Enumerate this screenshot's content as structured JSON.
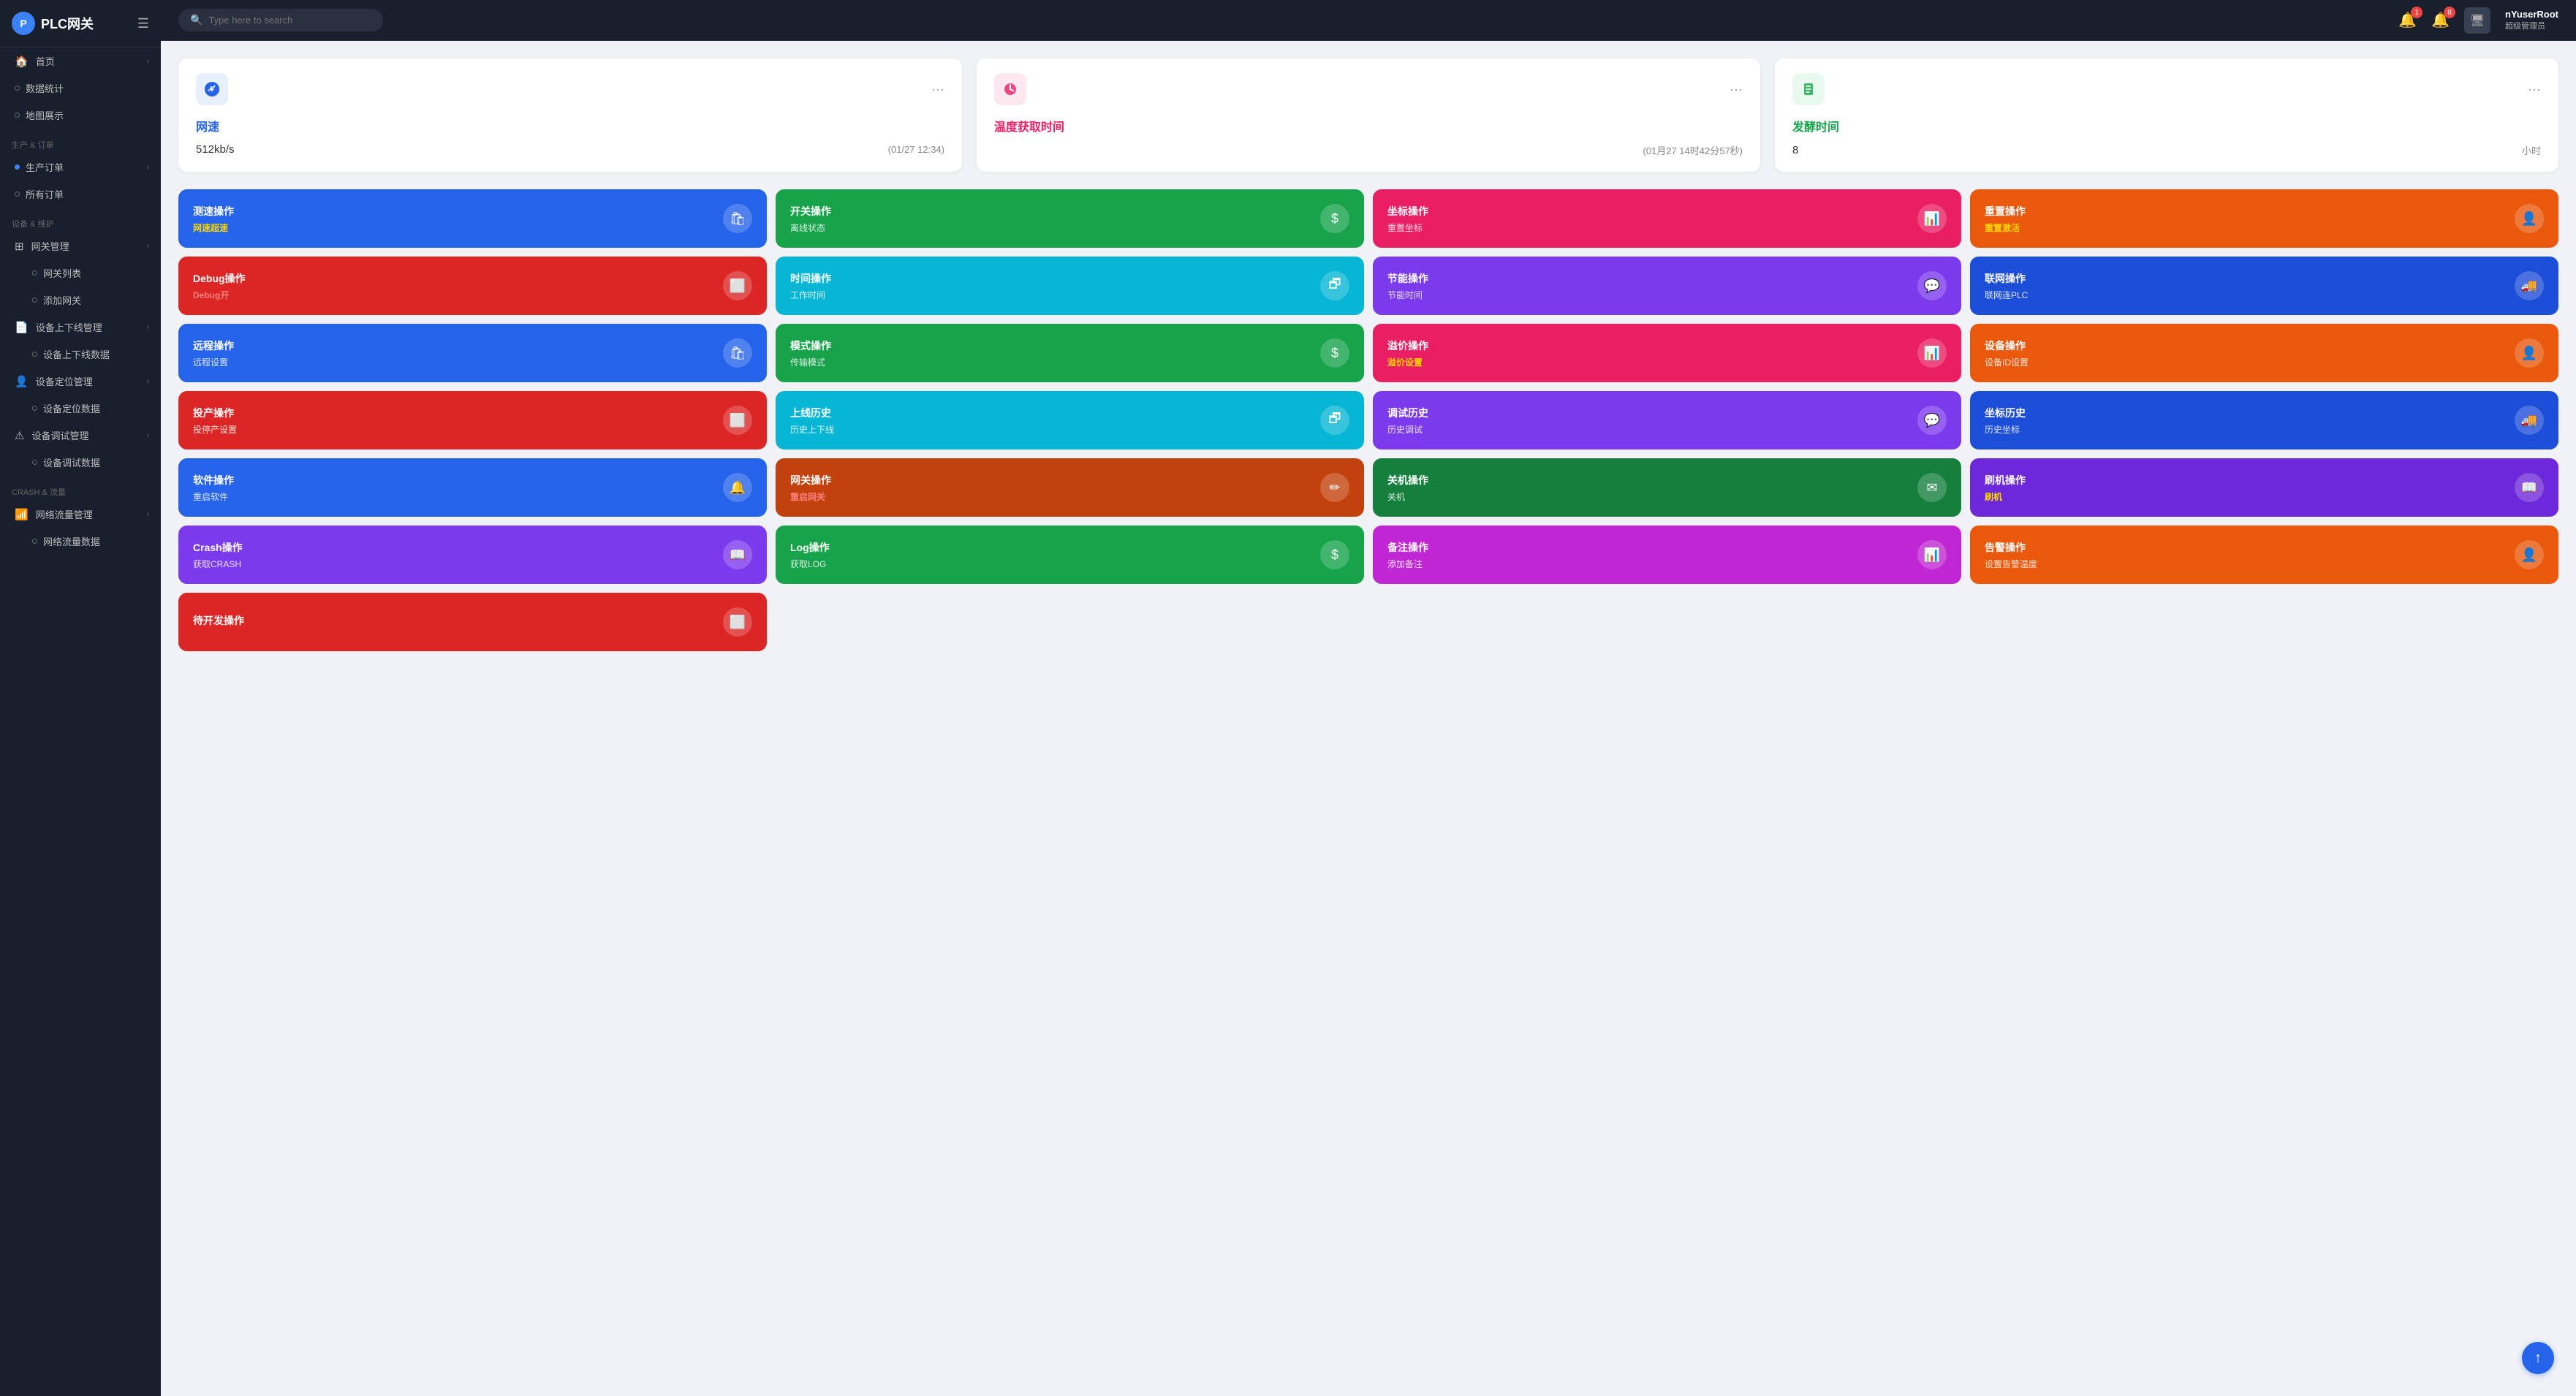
{
  "app": {
    "logo_text": "PLC网关",
    "hamburger": "☰"
  },
  "topbar": {
    "search_placeholder": "Type here to search",
    "notif1_count": "1",
    "notif2_count": "8",
    "user_name": "nYuserRoot",
    "user_role": "超级管理员"
  },
  "sidebar": {
    "section1_label": "",
    "items_main": [
      {
        "icon": "🏠",
        "label": "首页",
        "has_chevron": true,
        "type": "icon"
      },
      {
        "icon": "○",
        "label": "数据统计",
        "has_chevron": false,
        "type": "dot"
      },
      {
        "icon": "○",
        "label": "地图展示",
        "has_chevron": false,
        "type": "dot"
      }
    ],
    "section2_label": "生产 & 订单",
    "items_production": [
      {
        "label": "生产订单",
        "has_chevron": true,
        "type": "dot"
      },
      {
        "label": "所有订单",
        "has_chevron": false,
        "type": "dot"
      }
    ],
    "section3_label": "设备 & 维护",
    "items_device": [
      {
        "label": "网关管理",
        "has_chevron": true,
        "type": "grid"
      },
      {
        "label": "网关列表",
        "has_chevron": false,
        "type": "dot"
      },
      {
        "label": "添加网关",
        "has_chevron": false,
        "type": "dot"
      },
      {
        "label": "设备上下线管理",
        "has_chevron": true,
        "type": "file"
      },
      {
        "label": "设备上下线数据",
        "has_chevron": false,
        "type": "dot"
      },
      {
        "label": "设备定位管理",
        "has_chevron": true,
        "type": "person"
      },
      {
        "label": "设备定位数据",
        "has_chevron": false,
        "type": "dot"
      },
      {
        "label": "设备调试管理",
        "has_chevron": true,
        "type": "warn"
      },
      {
        "label": "设备调试数据",
        "has_chevron": false,
        "type": "dot"
      }
    ],
    "section4_label": "CRASH & 流量",
    "items_crash": [
      {
        "label": "网络流量管理",
        "has_chevron": true,
        "type": "chart"
      },
      {
        "label": "网络流量数据",
        "has_chevron": false,
        "type": "dot"
      }
    ]
  },
  "info_cards": [
    {
      "icon": "▲",
      "icon_style": "blue",
      "title": "网速",
      "title_color": "blue",
      "value": "512kb/s",
      "meta": "(01/27 12:34)"
    },
    {
      "icon": "✦",
      "icon_style": "pink",
      "title": "温度获取时间",
      "title_color": "pink",
      "value": "",
      "meta": "(01月27 14时42分57秒)"
    },
    {
      "icon": "▣",
      "icon_style": "green",
      "title": "发酵时间",
      "title_color": "green",
      "value": "8",
      "meta": "小时"
    }
  ],
  "action_cards": [
    {
      "title": "测速操作",
      "sub": "网速超速",
      "sub_style": "yellow",
      "bg": "bg-blue",
      "icon": "🛍"
    },
    {
      "title": "开关操作",
      "sub": "离线状态",
      "sub_style": "white",
      "bg": "bg-green",
      "icon": "$"
    },
    {
      "title": "坐标操作",
      "sub": "重置坐标",
      "sub_style": "white",
      "bg": "bg-pink",
      "icon": "📊"
    },
    {
      "title": "重置操作",
      "sub": "重置激活",
      "sub_style": "yellow",
      "bg": "bg-orange",
      "icon": "👤"
    },
    {
      "title": "Debug操作",
      "sub": "Debug开",
      "sub_style": "red-light",
      "bg": "bg-red",
      "icon": "⬜"
    },
    {
      "title": "时间操作",
      "sub": "工作时间",
      "sub_style": "white",
      "bg": "bg-cyan",
      "icon": "🗗"
    },
    {
      "title": "节能操作",
      "sub": "节能时间",
      "sub_style": "white",
      "bg": "bg-purple",
      "icon": "💬"
    },
    {
      "title": "联网操作",
      "sub": "联网连PLC",
      "sub_style": "white",
      "bg": "bg-blue2",
      "icon": "🚚"
    },
    {
      "title": "远程操作",
      "sub": "远程设置",
      "sub_style": "white",
      "bg": "bg-blue",
      "icon": "🛍"
    },
    {
      "title": "模式操作",
      "sub": "传输模式",
      "sub_style": "white",
      "bg": "bg-green",
      "icon": "$"
    },
    {
      "title": "溢价操作",
      "sub": "溢价设置",
      "sub_style": "yellow",
      "bg": "bg-pink",
      "icon": "📊"
    },
    {
      "title": "设备操作",
      "sub": "设备ID设置",
      "sub_style": "white",
      "bg": "bg-orange",
      "icon": "👤"
    },
    {
      "title": "投产操作",
      "sub": "投停产设置",
      "sub_style": "white",
      "bg": "bg-red",
      "icon": "⬜"
    },
    {
      "title": "上线历史",
      "sub": "历史上下线",
      "sub_style": "white",
      "bg": "bg-cyan",
      "icon": "🗗"
    },
    {
      "title": "调试历史",
      "sub": "历史调试",
      "sub_style": "white",
      "bg": "bg-purple",
      "icon": "💬"
    },
    {
      "title": "坐标历史",
      "sub": "历史坐标",
      "sub_style": "white",
      "bg": "bg-blue2",
      "icon": "🚚"
    },
    {
      "title": "软件操作",
      "sub": "重启软件",
      "sub_style": "white",
      "bg": "bg-blue",
      "icon": "🔔"
    },
    {
      "title": "网关操作",
      "sub": "重启网关",
      "sub_style": "red-light",
      "bg": "bg-orange2",
      "icon": "✏"
    },
    {
      "title": "关机操作",
      "sub": "关机",
      "sub_style": "white",
      "bg": "bg-green2",
      "icon": "✉"
    },
    {
      "title": "刷机操作",
      "sub": "刷机",
      "sub_style": "yellow",
      "bg": "bg-violet",
      "icon": "📖"
    },
    {
      "title": "Crash操作",
      "sub": "获取CRASH",
      "sub_style": "white",
      "bg": "bg-purple",
      "icon": "📖"
    },
    {
      "title": "Log操作",
      "sub": "获取LOG",
      "sub_style": "white",
      "bg": "bg-green",
      "icon": "$"
    },
    {
      "title": "备注操作",
      "sub": "添加备注",
      "sub_style": "white",
      "bg": "bg-fuchsia",
      "icon": "📊"
    },
    {
      "title": "告警操作",
      "sub": "设置告警温度",
      "sub_style": "white",
      "bg": "bg-orange",
      "icon": "👤"
    },
    {
      "title": "待开发操作",
      "sub": "",
      "sub_style": "white",
      "bg": "bg-red",
      "icon": "⬜"
    }
  ],
  "scroll_up": "↑"
}
